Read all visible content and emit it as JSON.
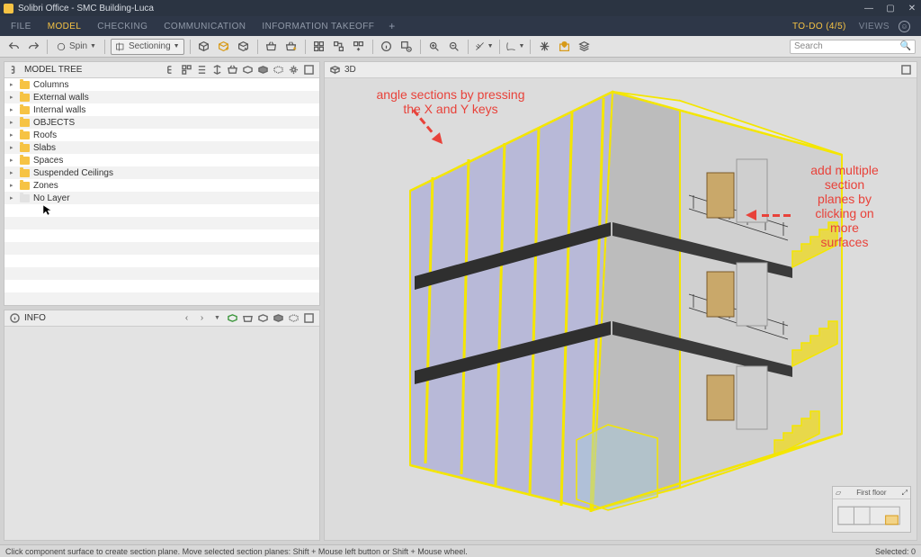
{
  "window": {
    "title": "Solibri Office - SMC Building-Luca",
    "minimize": "—",
    "maximize": "▢",
    "close": "✕"
  },
  "menubar": {
    "items": [
      "FILE",
      "MODEL",
      "CHECKING",
      "COMMUNICATION",
      "INFORMATION TAKEOFF"
    ],
    "active_index": 1,
    "plus": "+",
    "todo": "TO-DO (4/5)",
    "views": "VIEWS"
  },
  "toolbar": {
    "spin_label": "Spin",
    "sectioning_label": "Sectioning",
    "search_placeholder": "Search"
  },
  "model_tree": {
    "title": "MODEL TREE",
    "items": [
      {
        "label": "Columns",
        "dim": false
      },
      {
        "label": "External walls",
        "dim": false
      },
      {
        "label": "Internal walls",
        "dim": false
      },
      {
        "label": "OBJECTS",
        "dim": false
      },
      {
        "label": "Roofs",
        "dim": false
      },
      {
        "label": "Slabs",
        "dim": false
      },
      {
        "label": "Spaces",
        "dim": false
      },
      {
        "label": "Suspended Ceilings",
        "dim": false
      },
      {
        "label": "Zones",
        "dim": false
      },
      {
        "label": "No Layer",
        "dim": true
      }
    ]
  },
  "info_panel": {
    "title": "INFO"
  },
  "viewport": {
    "title": "3D",
    "navigator_floor": "First floor"
  },
  "annotations": {
    "a1_line1": "angle sections by pressing",
    "a1_line2": "the X and Y keys",
    "a2_line1": "add multiple",
    "a2_line2": "section",
    "a2_line3": "planes by",
    "a2_line4": "clicking on",
    "a2_line5": "more",
    "a2_line6": "surfaces"
  },
  "status": {
    "hint": "Click component surface to create section plane. Move selected section planes: Shift + Mouse left button or Shift + Mouse wheel.",
    "selected": "Selected: 0"
  },
  "colors": {
    "accent": "#f6c344",
    "annotation": "#e8423a",
    "section_edge": "#f4e600",
    "section_fill": "#9a9dd6"
  }
}
